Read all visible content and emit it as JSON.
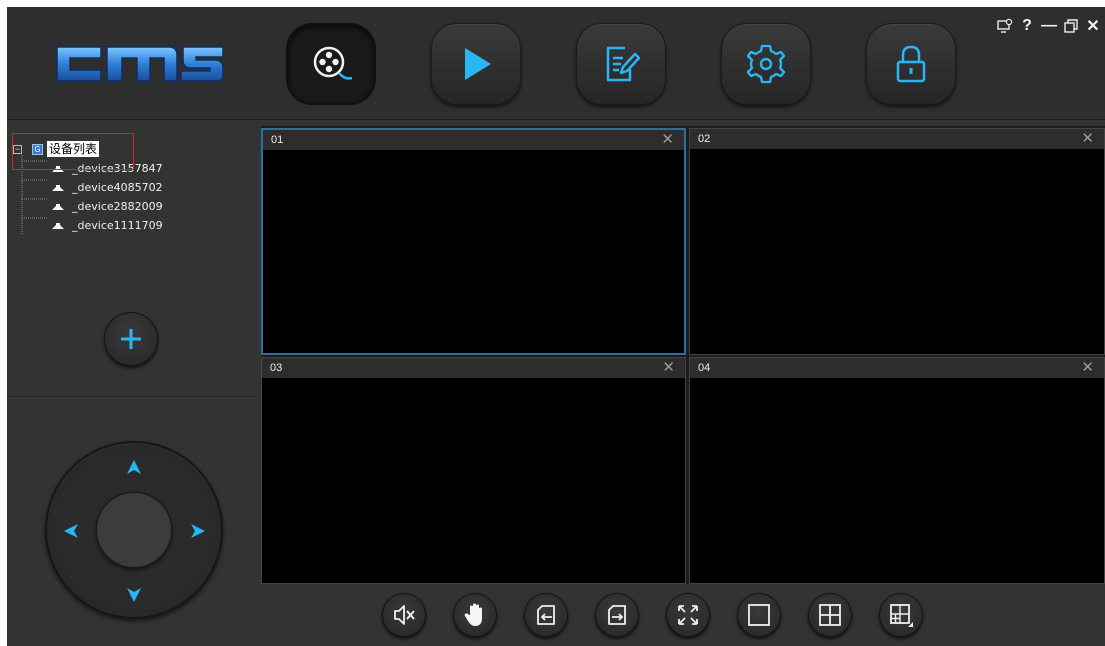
{
  "app": {
    "logo_text": "cms"
  },
  "nav": [
    {
      "name": "nav-live-view",
      "icon": "film-reel-icon",
      "active": true
    },
    {
      "name": "nav-playback",
      "icon": "play-icon",
      "active": false
    },
    {
      "name": "nav-log",
      "icon": "document-edit-icon",
      "active": false
    },
    {
      "name": "nav-settings",
      "icon": "gear-icon",
      "active": false
    },
    {
      "name": "nav-lock",
      "icon": "lock-icon",
      "active": false
    }
  ],
  "window_controls": {
    "question": "?",
    "minimize": "—",
    "close": "✕"
  },
  "tree": {
    "expander": "−",
    "root_badge": "G",
    "root_label": "设备列表",
    "devices": [
      {
        "label": "_device3157847"
      },
      {
        "label": "_device4085702"
      },
      {
        "label": "_device2882009"
      },
      {
        "label": "_device1111709"
      }
    ]
  },
  "panes": [
    {
      "id": "01",
      "active": true
    },
    {
      "id": "02",
      "active": false
    },
    {
      "id": "03",
      "active": false
    },
    {
      "id": "04",
      "active": false
    }
  ],
  "pane_close": "✕",
  "colors": {
    "accent": "#29b6f6",
    "background": "#333333",
    "active_border": "#2b6f9e",
    "highlight_box": "#d02828"
  },
  "toolbar": [
    {
      "name": "mute-button",
      "icon": "speaker-mute-icon"
    },
    {
      "name": "ptz-control-button",
      "icon": "hand-icon"
    },
    {
      "name": "previous-page-button",
      "icon": "page-back-icon"
    },
    {
      "name": "next-page-button",
      "icon": "page-forward-icon"
    },
    {
      "name": "fullscreen-button",
      "icon": "fullscreen-icon"
    },
    {
      "name": "layout-1-button",
      "icon": "single-view-icon"
    },
    {
      "name": "layout-4-button",
      "icon": "quad-view-icon"
    },
    {
      "name": "layout-more-button",
      "icon": "multi-view-icon"
    }
  ]
}
